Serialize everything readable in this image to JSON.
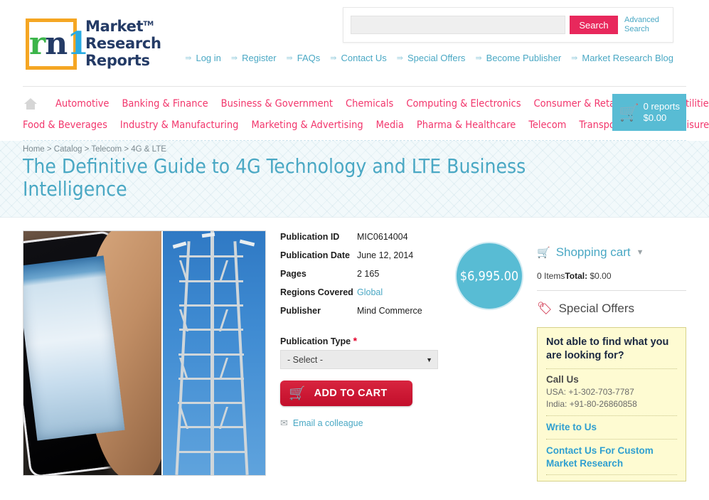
{
  "brand": {
    "logo_letter": "m",
    "name_line1": "Market",
    "name_line2": "Research",
    "name_line3": "Reports",
    "trademark": "TM"
  },
  "search": {
    "value": "",
    "placeholder": "",
    "button_label": "Search",
    "advanced_label": "Advanced Search"
  },
  "toplinks": [
    {
      "label": "Log in"
    },
    {
      "label": "Register"
    },
    {
      "label": "FAQs"
    },
    {
      "label": "Contact Us"
    },
    {
      "label": "Special Offers"
    },
    {
      "label": "Become Publisher"
    },
    {
      "label": "Market Research Blog"
    }
  ],
  "nav": {
    "row1": [
      {
        "label": "Automotive"
      },
      {
        "label": "Banking & Finance"
      },
      {
        "label": "Business & Government"
      },
      {
        "label": "Chemicals"
      },
      {
        "label": "Computing & Electronics"
      },
      {
        "label": "Consumer & Retail"
      },
      {
        "label": "Energy & Utilities"
      }
    ],
    "row2": [
      {
        "label": "Food & Beverages"
      },
      {
        "label": "Industry & Manufacturing"
      },
      {
        "label": "Marketing & Advertising"
      },
      {
        "label": "Media"
      },
      {
        "label": "Pharma & Healthcare"
      },
      {
        "label": "Telecom"
      },
      {
        "label": "Transport"
      },
      {
        "label": "Travel & Leisure"
      }
    ]
  },
  "cart_widget": {
    "count_label": "0 reports",
    "total_label": "$0.00"
  },
  "breadcrumb": {
    "home": "Home",
    "sep1": " > ",
    "catalog": "Catalog",
    "sep2": " > ",
    "category": "Telecom",
    "sep3": " > ",
    "subcategory": "4G & LTE",
    "full": "Home > Catalog > Telecom > 4G & LTE"
  },
  "page_title": "The Definitive Guide to 4G Technology and LTE Business Intelligence",
  "product": {
    "image_alt": "Smartphone in hand beside a cellular transmission tower",
    "price": "$6,995.00",
    "specs": [
      {
        "key": "Publication ID",
        "value": "MIC0614004",
        "link": false
      },
      {
        "key": "Publication Date",
        "value": "June 12, 2014",
        "link": false
      },
      {
        "key": "Pages",
        "value": "2 165",
        "link": false
      },
      {
        "key": "Regions Covered",
        "value": "Global",
        "link": true
      },
      {
        "key": "Publisher",
        "value": "Mind Commerce",
        "link": false
      }
    ],
    "publication_type_label": "Publication Type",
    "required_mark": "*",
    "publication_type_selected": "- Select -",
    "publication_type_options": [
      "- Select -"
    ],
    "add_to_cart_label": "ADD TO CART",
    "email_colleague_label": "Email a colleague"
  },
  "sidebar": {
    "cart_title": "Shopping cart",
    "cart_items": "0 Items",
    "cart_total_label": "Total:",
    "cart_total_value": "$0.00",
    "special_offers_title": "Special Offers",
    "help_box": {
      "title": "Not able to find what you are looking for?",
      "call_us_heading": "Call Us",
      "usa_phone": "USA: +1-302-703-7787",
      "india_phone": "India: +91-80-26860858",
      "write_to_us": "Write to Us",
      "custom_research": "Contact Us For Custom Market Research"
    }
  },
  "colors": {
    "accent_pink": "#f2366c",
    "search_button": "#e8285c",
    "teal": "#4aa8c4",
    "cart_teal": "#58bcd4",
    "cart_red": "#c20e2b",
    "logo_orange": "#f5a623",
    "logo_navy": "#243b66",
    "logo_green": "#3bb54a",
    "logo_cyan": "#29abe2",
    "help_box_bg": "#fefbd2"
  }
}
